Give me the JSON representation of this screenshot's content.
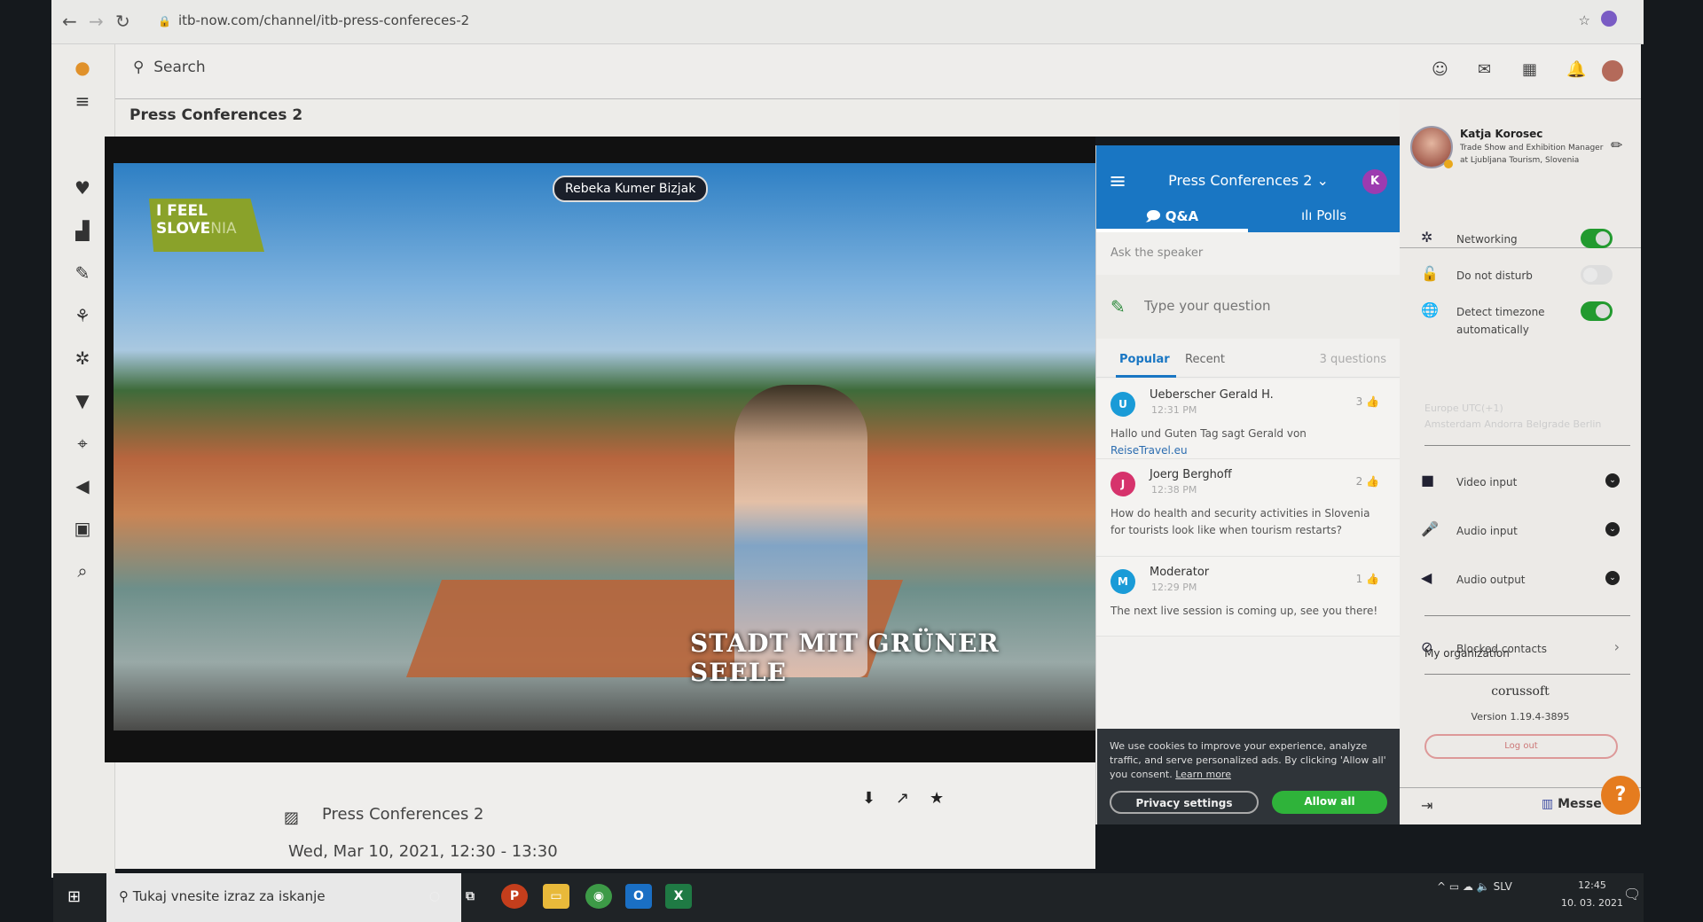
{
  "browser": {
    "url": "itb-now.com/channel/itb-press-confereces-2"
  },
  "header": {
    "search_placeholder": "Search",
    "page_title": "Press Conferences 2"
  },
  "video": {
    "speaker": "Rebeka Kumer Bizjak",
    "logo_line1": "I FEEL",
    "logo_line2a": "SLOVE",
    "logo_line2b": "NIA",
    "caption": "STADT MIT GRÜNER SEELE"
  },
  "event": {
    "title": "Press Conferences 2",
    "date": "Wed, Mar 10, 2021, 12:30 - 13:30"
  },
  "qa": {
    "channel": "Press Conferences 2 ⌄",
    "avatar": "K",
    "tabs": [
      {
        "label": "Q&A",
        "icon": "chat-icon",
        "active": true
      },
      {
        "label": "Polls",
        "icon": "bar-chart-icon"
      }
    ],
    "ask_label": "Ask the speaker",
    "input_placeholder": "Type your question",
    "sort_tabs": [
      "Popular",
      "Recent"
    ],
    "count": "3 questions",
    "questions": [
      {
        "initial": "U",
        "color": "#1a9bd7",
        "name": "Ueberscher Gerald H.",
        "time": "12:31 PM",
        "likes": "3",
        "text": "Hallo und Guten Tag sagt Gerald von ",
        "link": "ReiseTravel.eu"
      },
      {
        "initial": "J",
        "color": "#d6336c",
        "name": "Joerg Berghoff",
        "time": "12:38 PM",
        "likes": "2",
        "text": "How do health and security activities in Slovenia for tourists look like when tourism restarts?"
      },
      {
        "initial": "M",
        "color": "#1a9bd7",
        "name": "Moderator",
        "time": "12:29 PM",
        "likes": "1",
        "text": "The next live session is coming up, see you there!"
      }
    ]
  },
  "cookie": {
    "text": "We use cookies to improve your experience, analyze traffic, and serve personalized ads. By clicking 'Allow all' you consent. ",
    "learn_more": "Learn more",
    "privacy": "Privacy settings",
    "allow": "Allow all"
  },
  "profile": {
    "name": "Katja Korosec",
    "role1": "Trade Show and Exhibition Manager",
    "role2": "at Ljubljana Tourism, Slovenia"
  },
  "settings": {
    "networking": {
      "label": "Networking",
      "on": true
    },
    "dnd": {
      "label": "Do not disturb",
      "on": false
    },
    "timezone": {
      "label1": "Detect timezone",
      "label2": "automatically",
      "on": true
    },
    "tz_value1": "Europe UTC(+1)",
    "tz_value2": "Amsterdam Andorra Belgrade Berlin",
    "video_input": "Video input",
    "audio_input": "Audio input",
    "audio_output": "Audio output",
    "blocked": "Blocked contacts",
    "my_org": "My organization",
    "brand": "corussoft",
    "version": "Version 1.19.4-3895",
    "logout": "Log out",
    "messe": "Messe",
    "help": "?"
  },
  "taskbar": {
    "search": "Tukaj vnesite izraz za iskanje",
    "lang": "SLV",
    "time": "12:45",
    "date": "10. 03. 2021"
  },
  "colors": {
    "accent": "#1976c3",
    "toggle_on": "#229a2f",
    "allow": "#2fb33a",
    "help": "#e57c1f"
  }
}
